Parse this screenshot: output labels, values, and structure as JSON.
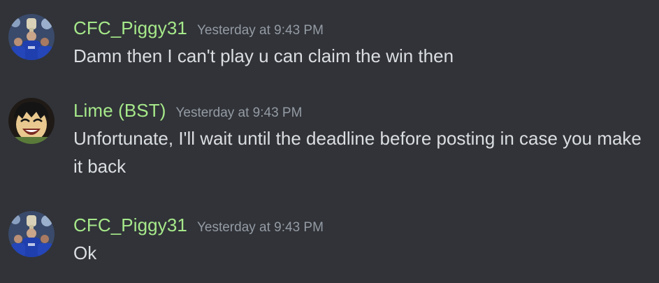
{
  "messages": [
    {
      "author": "CFC_Piggy31",
      "timestamp": "Yesterday at 9:43 PM",
      "content": "Damn then I can't play u can claim the win then",
      "avatar": "chelsea-players-trophy-avatar",
      "name_color": "#a6e88a"
    },
    {
      "author": "Lime (BST)",
      "timestamp": "Yesterday at 9:43 PM",
      "content": "Unfortunate, I'll wait until the deadline before posting in case you make it back",
      "avatar": "toph-cartoon-avatar",
      "name_color": "#a6e88a"
    },
    {
      "author": "CFC_Piggy31",
      "timestamp": "Yesterday at 9:43 PM",
      "content": "Ok",
      "avatar": "chelsea-players-trophy-avatar",
      "name_color": "#a6e88a"
    }
  ]
}
